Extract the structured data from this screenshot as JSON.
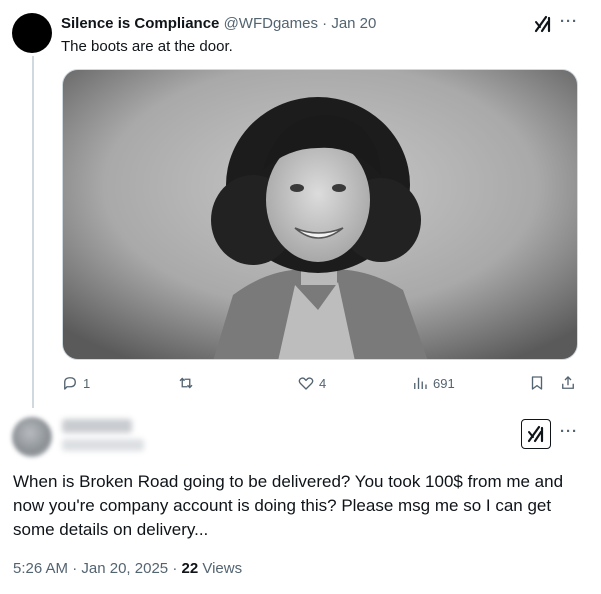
{
  "tweet1": {
    "author_name": "Silence is Compliance",
    "handle": "@WFDgames",
    "separator": "·",
    "date": "Jan 20",
    "text": "The boots are at the door.",
    "image_icon": "photo-portrait",
    "actions": {
      "replies": "1",
      "reposts": "",
      "likes": "4",
      "views": "691"
    },
    "icons": {
      "grok": "grok-icon",
      "more": "more-icon",
      "reply": "reply-icon",
      "repost": "repost-icon",
      "like": "heart-icon",
      "views": "views-icon",
      "bookmark": "bookmark-icon",
      "share": "share-icon"
    }
  },
  "tweet2": {
    "author_name_redacted": true,
    "text": "When is Broken Road going to be delivered? You took 100$ from me and now you're company account is doing this? Please msg me so I can get some details on delivery...",
    "time": "5:26 AM",
    "separator": "·",
    "date": "Jan 20, 2025",
    "views_count": "22",
    "views_label": "Views",
    "icons": {
      "grok": "grok-icon",
      "more": "more-icon"
    }
  },
  "colors": {
    "text_primary": "#0f1419",
    "text_secondary": "#536471",
    "border": "#cfd9de",
    "background": "#ffffff"
  }
}
